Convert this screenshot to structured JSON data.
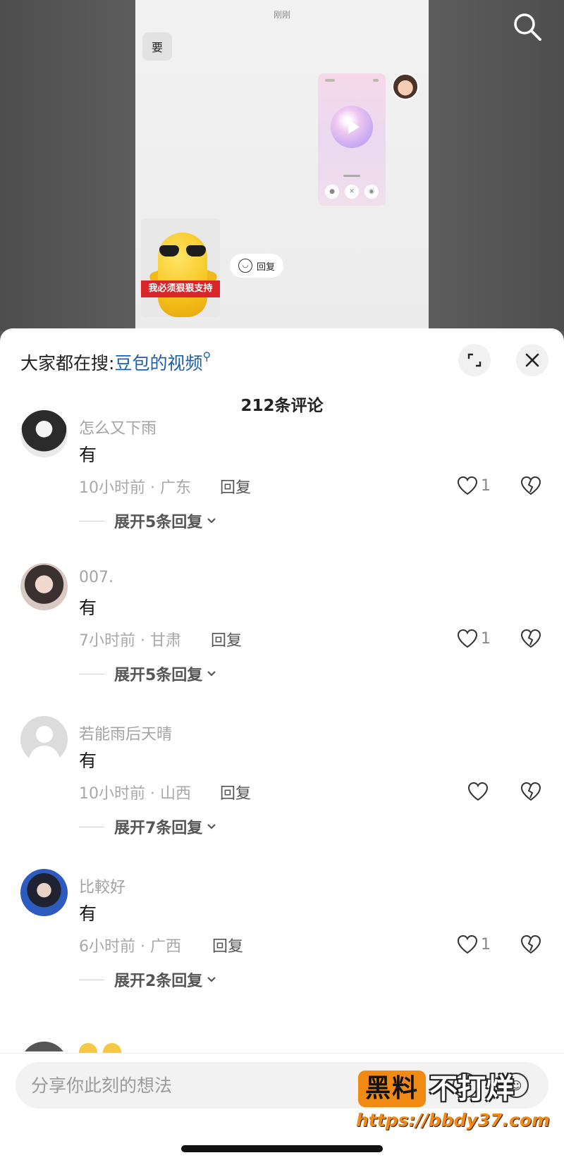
{
  "video": {
    "timestamp": "刚刚",
    "message_bubble": "要",
    "sticker_caption": "我必须狠狠支持",
    "reply_chip_label": "回复"
  },
  "sheet": {
    "hot_search_prefix": "大家都在搜:",
    "hot_search_link": "豆包的视频",
    "comment_count_title": "212条评论"
  },
  "comments": [
    {
      "user": "怎么又下雨",
      "text": "有",
      "meta": "10小时前 · 广东",
      "reply_label": "回复",
      "likes": "1",
      "expand_label": "展开5条回复"
    },
    {
      "user": "007.",
      "text": "有",
      "meta": "7小时前 · 甘肃",
      "reply_label": "回复",
      "likes": "1",
      "expand_label": "展开5条回复"
    },
    {
      "user": "若能雨后天晴",
      "text": "有",
      "meta": "10小时前 · 山西",
      "reply_label": "回复",
      "likes": "",
      "expand_label": "展开7条回复"
    },
    {
      "user": "比較好",
      "text": "有",
      "meta": "6小时前 · 广西",
      "reply_label": "回复",
      "likes": "1",
      "expand_label": "展开2条回复"
    }
  ],
  "input": {
    "placeholder": "分享你此刻的想法"
  },
  "watermark": {
    "badge": "黑料",
    "text": "不打烊",
    "url": "https://bbdy37.com"
  },
  "colors": {
    "link_blue": "#1e5fa8",
    "sticker_red": "#d9262a",
    "watermark_orange": "#f08a12"
  }
}
